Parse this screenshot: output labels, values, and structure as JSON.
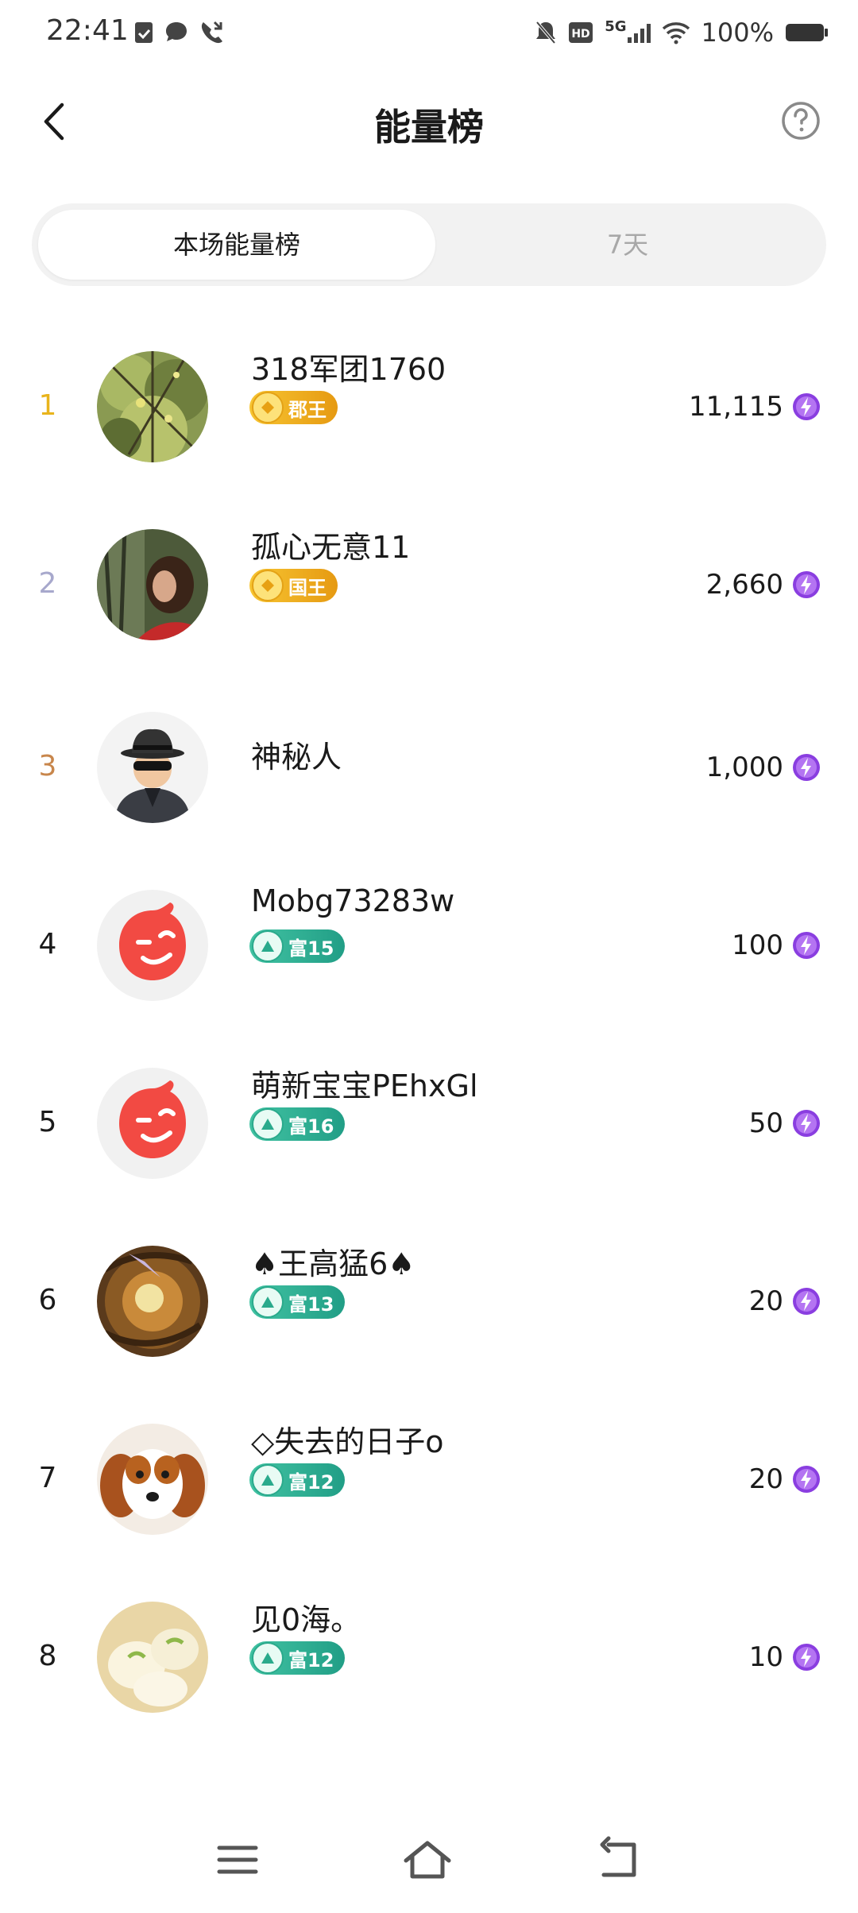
{
  "status_bar": {
    "time": "22:41",
    "network": "5G",
    "battery": "100%"
  },
  "header": {
    "title": "能量榜"
  },
  "tabs": [
    {
      "label": "本场能量榜",
      "active": true
    },
    {
      "label": "7天",
      "active": false
    }
  ],
  "ranking": [
    {
      "rank": "1",
      "name": "318军团1760",
      "badge": "郡王",
      "badge_style": "gold",
      "score": "11,115",
      "rank_color": "#e9b41c",
      "avatar": "tree-photo"
    },
    {
      "rank": "2",
      "name": "孤心无意11",
      "badge": "国王",
      "badge_style": "gold",
      "score": "2,660",
      "rank_color": "#a7a8cc",
      "avatar": "woman-photo"
    },
    {
      "rank": "3",
      "name": "神秘人",
      "badge": "",
      "badge_style": "none",
      "score": "1,000",
      "rank_color": "#c8864b",
      "avatar": "mystery-man"
    },
    {
      "rank": "4",
      "name": "Mobg73283w",
      "badge": "富15",
      "badge_style": "green",
      "score": "100",
      "rank_color": "#1a1a1a",
      "avatar": "wink-face"
    },
    {
      "rank": "5",
      "name": "萌新宝宝PEhxGl",
      "badge": "富16",
      "badge_style": "green",
      "score": "50",
      "rank_color": "#1a1a1a",
      "avatar": "wink-face"
    },
    {
      "rank": "6",
      "name": "♠王高猛6♠",
      "badge": "富13",
      "badge_style": "green",
      "score": "20",
      "rank_color": "#1a1a1a",
      "avatar": "dragon-art"
    },
    {
      "rank": "7",
      "name": "◇失去的日子o",
      "badge": "富12",
      "badge_style": "green",
      "score": "20",
      "rank_color": "#1a1a1a",
      "avatar": "puppy-photo"
    },
    {
      "rank": "8",
      "name": "见0海。",
      "badge": "富12",
      "badge_style": "green",
      "score": "10",
      "rank_color": "#1a1a1a",
      "avatar": "dessert-photo"
    }
  ],
  "colors": {
    "accent_purple": "#8a3ee0",
    "wink_red": "#f24a43",
    "tab_bg": "#f2f2f2"
  }
}
